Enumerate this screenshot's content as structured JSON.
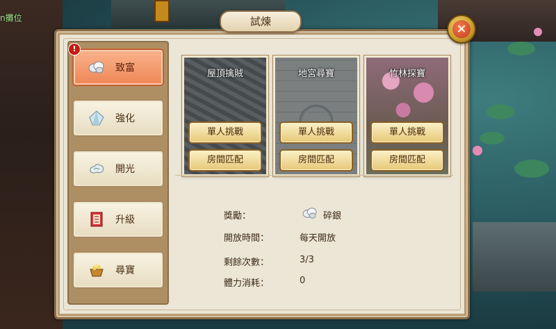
{
  "background": {
    "location_text": "n攤位"
  },
  "window": {
    "title": "試煉",
    "close_icon": "close-icon"
  },
  "sidebar": {
    "items": [
      {
        "label": "致富",
        "icon": "silver-ingot-icon",
        "active": true,
        "alert": "!"
      },
      {
        "label": "強化",
        "icon": "crystal-icon",
        "active": false
      },
      {
        "label": "開光",
        "icon": "cloud-swirl-icon",
        "active": false
      },
      {
        "label": "升級",
        "icon": "scroll-book-icon",
        "active": false
      },
      {
        "label": "尋寶",
        "icon": "treasure-bowl-icon",
        "active": false
      }
    ]
  },
  "challenges": [
    {
      "name": "屋頂擒賊",
      "single_label": "單人挑戰",
      "match_label": "房間匹配",
      "scene": "rooftop"
    },
    {
      "name": "地宮尋寶",
      "single_label": "單人挑戰",
      "match_label": "房間匹配",
      "scene": "underground-palace"
    },
    {
      "name": "竹林探寶",
      "single_label": "單人挑戰",
      "match_label": "房間匹配",
      "scene": "bamboo-forest"
    }
  ],
  "info": {
    "reward_label": "獎勵：",
    "reward_value": "碎銀",
    "reward_icon": "silver-ingot-icon",
    "open_time_label": "開放時間：",
    "open_time_value": "每天開放",
    "remaining_label": "剩餘次數：",
    "remaining_value": "3/3",
    "stamina_label": "體力消耗：",
    "stamina_value": "0"
  },
  "colors": {
    "panel_bg": "#ebe6d6",
    "active_tab": "#ef8656",
    "button_gold": "#e6c878",
    "alert_red": "#c51b12"
  }
}
